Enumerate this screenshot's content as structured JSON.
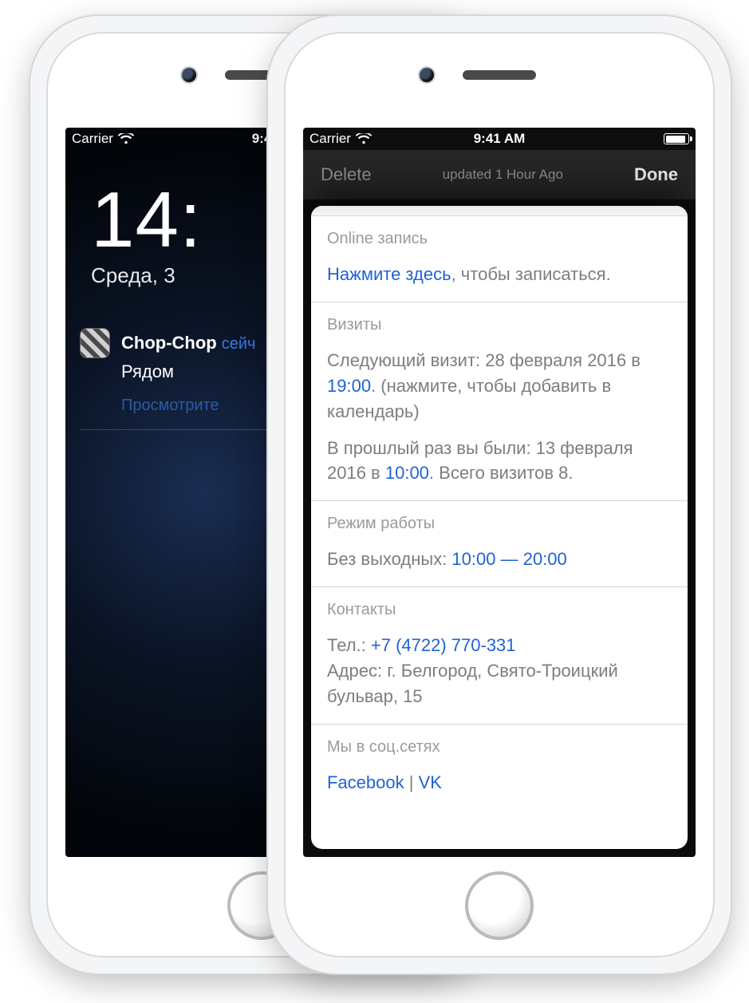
{
  "status": {
    "carrier": "Carrier",
    "time": "9:41 AM",
    "time_left_visible": "9:4"
  },
  "lock": {
    "time_visible": "14:",
    "date_visible": "Среда, 3",
    "notification": {
      "app": "Chop-Chop",
      "when_visible": "сейч",
      "body": "Рядом",
      "action": "Просмотрите"
    }
  },
  "detail": {
    "delete": "Delete",
    "updated": "updated 1 Hour Ago",
    "done": "Done",
    "sections": {
      "online": {
        "title": "Online запись",
        "link": "Нажмите здесь",
        "rest": ", чтобы записаться."
      },
      "visits": {
        "title": "Визиты",
        "next_pre": "Следующий визит: 28 февраля 2016 в ",
        "next_time": "19:00",
        "next_post": ". (нажмите, чтобы добавить в календарь)",
        "prev_pre": "В прошлый раз вы были: 13 февраля 2016 в ",
        "prev_time": "10:00",
        "prev_post": ". Всего визитов 8."
      },
      "hours": {
        "title": "Режим работы",
        "pre": "Без выходных: ",
        "open": "10:00",
        "dash": " — ",
        "close": "20:00"
      },
      "contacts": {
        "title": "Контакты",
        "tel_label": "Тел.: ",
        "tel": "+7 (4722) 770-331",
        "addr": "Адрес: г. Белгород, Свято-Троицкий бульвар, 15"
      },
      "social": {
        "title": "Мы в соц.сетях",
        "fb": "Facebook",
        "sep": " | ",
        "vk": "VK"
      }
    }
  }
}
